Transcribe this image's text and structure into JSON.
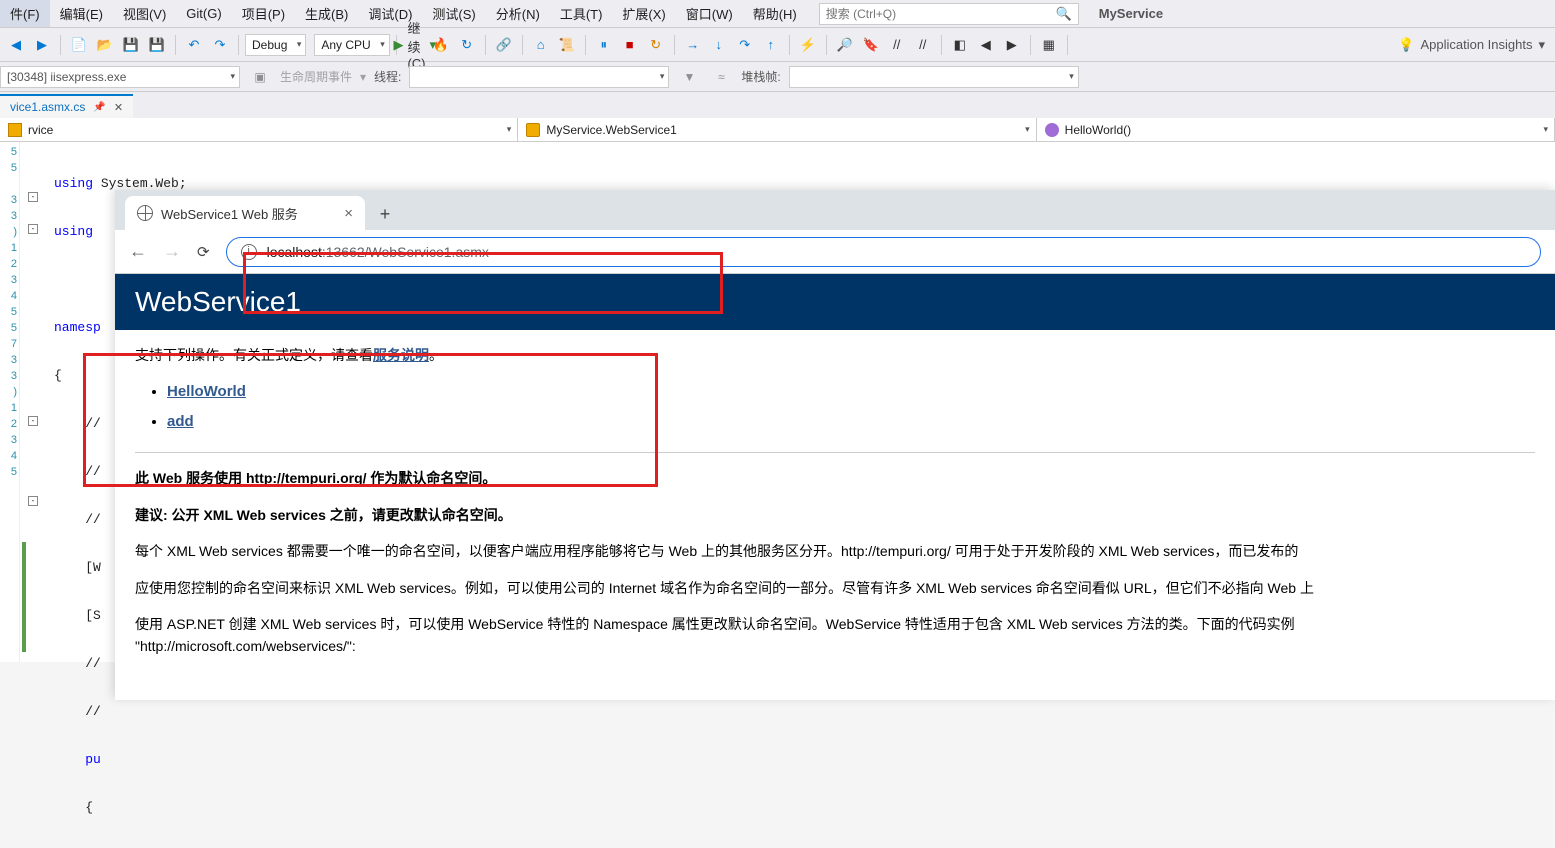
{
  "menubar": {
    "items": [
      "件(F)",
      "编辑(E)",
      "视图(V)",
      "Git(G)",
      "项目(P)",
      "生成(B)",
      "调试(D)",
      "测试(S)",
      "分析(N)",
      "工具(T)",
      "扩展(X)",
      "窗口(W)",
      "帮助(H)"
    ],
    "search_placeholder": "搜索 (Ctrl+Q)",
    "solution": "MyService"
  },
  "toolbar": {
    "config": "Debug",
    "platform": "Any CPU",
    "continue": "继续(C)",
    "app_insights": "Application Insights"
  },
  "debugbar": {
    "process": "[30348] iisexpress.exe",
    "lifecycle": "生命周期事件",
    "thread_label": "线程:",
    "stackframe_label": "堆栈帧:"
  },
  "doctab": {
    "name": "vice1.asmx.cs"
  },
  "nav": {
    "project": "rvice",
    "class": "MyService.WebService1",
    "method": "HelloWorld()"
  },
  "code": {
    "line1_kw": "using",
    "line1_rest": " System.Web;",
    "line2_kw": "using",
    "ns_kw": "namesp",
    "brace": "{",
    "pu": "pu",
    "slashes": "//",
    "bracket_w": "[W",
    "bracket_s": "[S"
  },
  "gutter_lines": [
    "",
    "",
    "",
    "",
    "",
    "",
    "",
    "",
    "",
    "",
    "",
    "",
    "",
    "",
    "",
    "",
    "",
    "",
    "",
    "",
    "",
    ""
  ],
  "browser": {
    "tab_title": "WebService1 Web 服务",
    "url_host": "localhost",
    "url_rest": ":13662/WebService1.asmx"
  },
  "ws": {
    "title": "WebService1",
    "intro_before": "支持下列操作。有关正式定义，请查看",
    "intro_link": "服务说明",
    "intro_after": "。",
    "ops": [
      "HelloWorld",
      "add"
    ],
    "p1": "此 Web 服务使用 http://tempuri.org/ 作为默认命名空间。",
    "p2": "建议: 公开 XML Web services 之前，请更改默认命名空间。",
    "p3": "每个 XML Web services 都需要一个唯一的命名空间，以便客户端应用程序能够将它与 Web 上的其他服务区分开。http://tempuri.org/ 可用于处于开发阶段的 XML Web services，而已发布的",
    "p4": "应使用您控制的命名空间来标识 XML Web services。例如，可以使用公司的 Internet 域名作为命名空间的一部分。尽管有许多 XML Web services 命名空间看似 URL，但它们不必指向 Web 上",
    "p5": "使用 ASP.NET 创建 XML Web services 时，可以使用 WebService 特性的 Namespace 属性更改默认命名空间。WebService 特性适用于包含 XML Web services 方法的类。下面的代码实例",
    "p5b": "\"http://microsoft.com/webservices/\":"
  }
}
